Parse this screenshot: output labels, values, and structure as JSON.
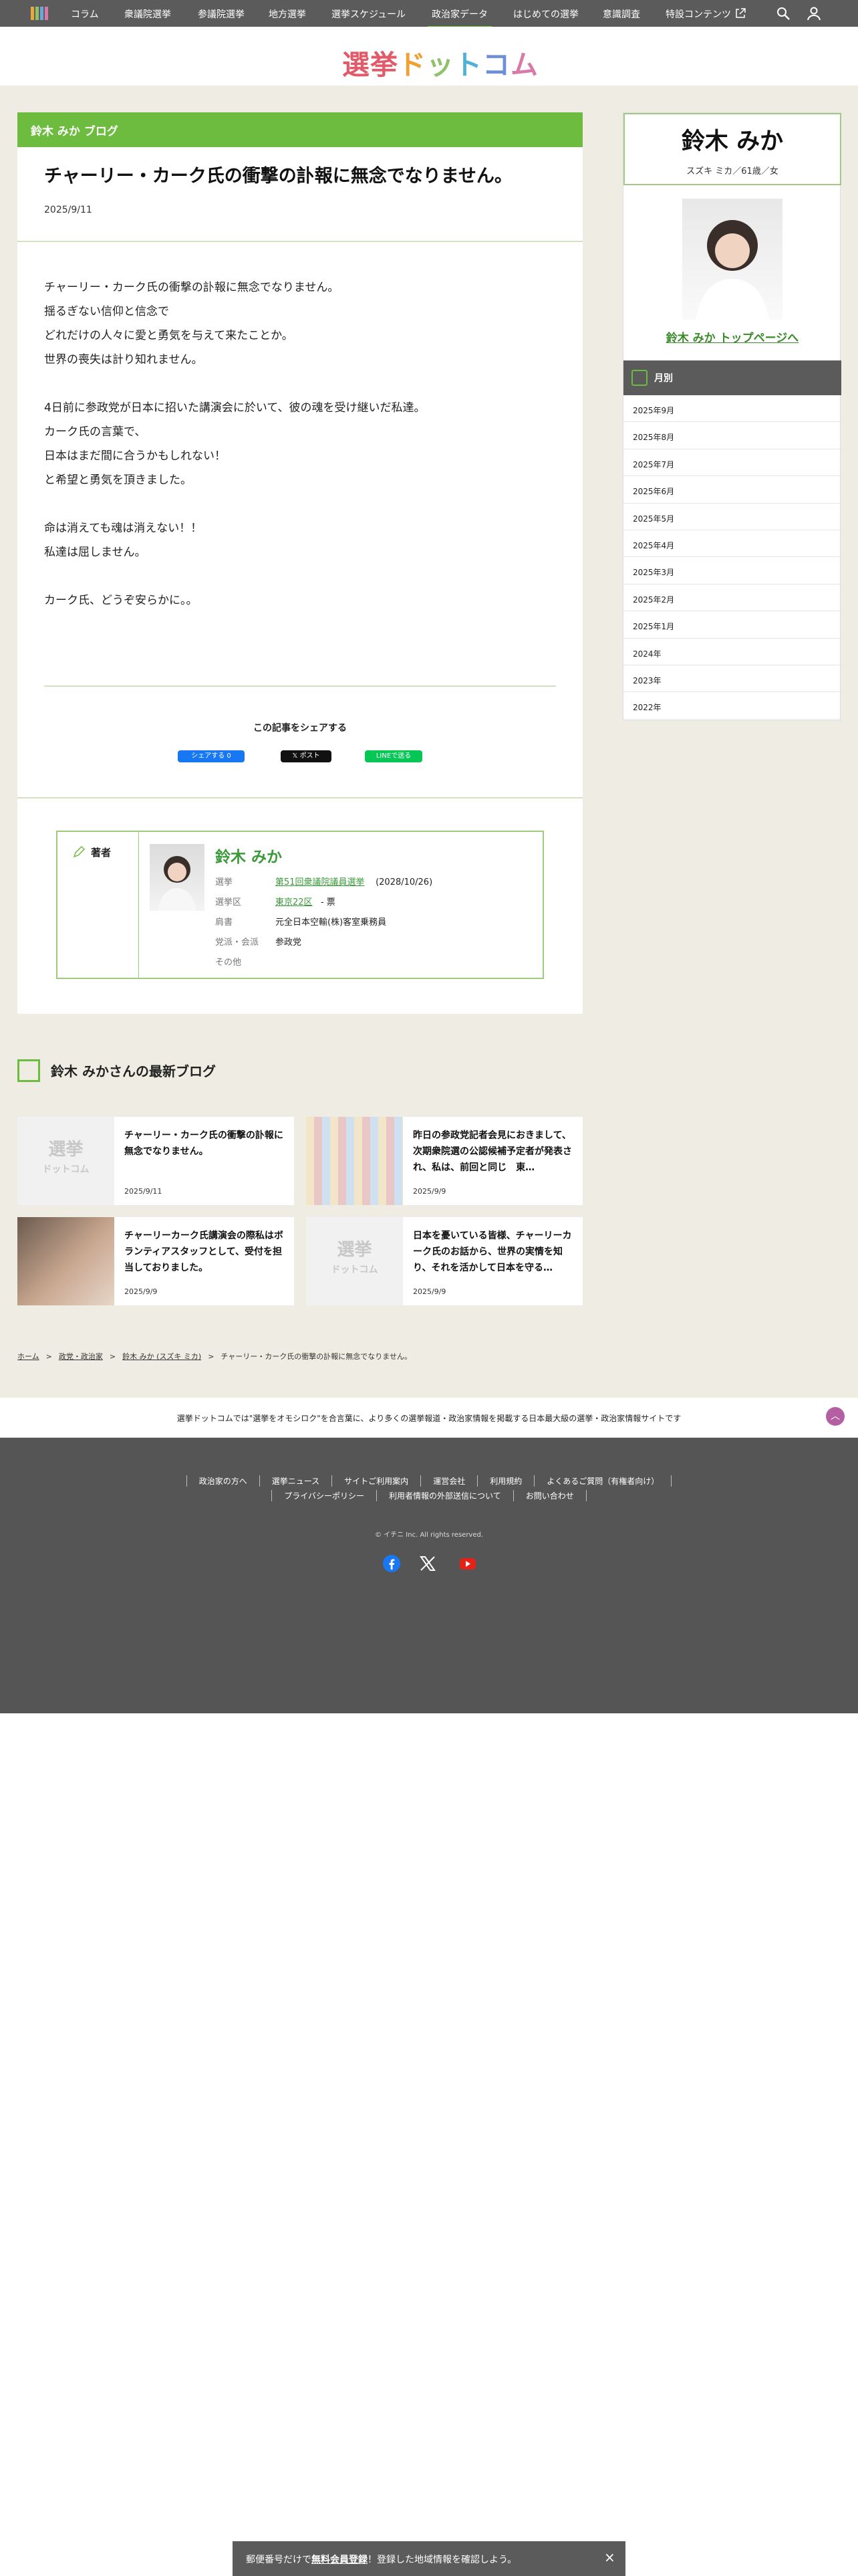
{
  "topnav": {
    "items": [
      "コラム",
      "衆議院選挙",
      "参議院選挙",
      "地方選挙",
      "選挙スケジュール",
      "政治家データ",
      "はじめての選挙",
      "意識調査",
      "特設コンテンツ"
    ],
    "active_index": 5,
    "icons": [
      "menu-icon",
      "search-icon",
      "user-icon",
      "external-link-icon"
    ]
  },
  "logo": {
    "text": "選挙ドットコム"
  },
  "post": {
    "blog_header": "鈴木 みか ブログ",
    "title": "チャーリー・カーク氏の衝撃の訃報に無念でなりません。",
    "date": "2025/9/11",
    "body": [
      "チャーリー・カーク氏の衝撃の訃報に無念でなりません。",
      "揺るぎない信仰と信念で",
      "どれだけの人々に愛と勇気を与えて来たことか。",
      "世界の喪失は計り知れません。",
      "",
      "4日前に参政党が日本に招いた講演会に於いて、彼の魂を受け継いだ私達。",
      "カーク氏の言葉で、",
      "日本はまだ間に合うかもしれない！",
      "と希望と勇気を頂きました。",
      "",
      "命は消えても魂は消えない！！",
      "私達は屈しません。",
      "",
      "カーク氏、どうぞ安らかに。。"
    ],
    "share_label": "この記事をシェアする",
    "share_buttons": {
      "facebook": "シェアする 0",
      "x": "ポスト",
      "line": "LINEで送る"
    }
  },
  "author": {
    "label": "著者",
    "name": "鈴木 みか",
    "rows": [
      {
        "key": "選挙",
        "value": "第51回衆議院議員選挙",
        "extra": "(2028/10/26)"
      },
      {
        "key": "選挙区",
        "value": "東京22区",
        "extra": "- 票"
      },
      {
        "key": "肩書",
        "value": "元全日本空輸(株)客室乗務員",
        "extra": ""
      },
      {
        "key": "党派・会派",
        "value": "参政党",
        "extra": ""
      },
      {
        "key": "その他",
        "value": "",
        "extra": ""
      }
    ]
  },
  "latest": {
    "title": "鈴木 みかさんの最新ブログ",
    "placeholder_logo": "選挙",
    "placeholder_sub": "ドットコム",
    "cards": [
      {
        "title": "チャーリー・カーク氏の衝撃の訃報に無念でなりません。",
        "date": "2025/9/11"
      },
      {
        "title": "昨日の参政党記者会見におきまして、次期衆院選の公認候補予定者が発表され、私は、前回と同じ　東…",
        "date": "2025/9/9"
      },
      {
        "title": "チャーリーカーク氏講演会の際私はボランティアスタッフとして、受付を担当しておりました。",
        "date": "2025/9/9"
      },
      {
        "title": "日本を憂いている皆様、チャーリーカーク氏のお話から、世界の実情を知り、それを活かして日本を守る…",
        "date": "2025/9/9"
      }
    ]
  },
  "breadcrumb": [
    "ホーム",
    "政党・政治家",
    "鈴木 みか (スズキ ミカ)",
    "チャーリー・カーク氏の衝撃の訃報に無念でなりません。"
  ],
  "sidebar": {
    "name": "鈴木 みか",
    "meta": "スズキ ミカ／61歳／女",
    "top_link": "鈴木 みか トップページへ",
    "month_header": "月別",
    "months": [
      "2025年9月",
      "2025年8月",
      "2025年7月",
      "2025年6月",
      "2025年5月",
      "2025年4月",
      "2025年3月",
      "2025年2月",
      "2025年1月",
      "2024年",
      "2023年",
      "2022年"
    ]
  },
  "footer": {
    "tagline": "選挙ドットコムでは\"選挙をオモシロク\"を合言葉に、より多くの選挙報道・政治家情報を掲載する日本最大級の選挙・政治家情報サイトです",
    "links_row1": [
      "政治家の方へ",
      "選挙ニュース",
      "サイトご利用案内",
      "運営会社",
      "利用規約",
      "よくあるご質問（有権者向け）"
    ],
    "links_row2": [
      "プライバシーポリシー",
      "利用者情報の外部送信について",
      "お問い合わせ"
    ],
    "copyright": "© イチニ Inc. All rights reserved.",
    "sns": [
      "facebook-icon",
      "x-icon",
      "youtube-icon"
    ]
  },
  "notice": {
    "prefix": "郵便番号だけで",
    "link": "無料会員登録",
    "suffix": "！登録した地域情報を確認しよう。",
    "close": "×"
  },
  "colors": {
    "accent_green": "#6dbb3f",
    "nav_gray": "#5b5b5b",
    "beige": "#efede3",
    "link_green": "#3a9a3a"
  }
}
